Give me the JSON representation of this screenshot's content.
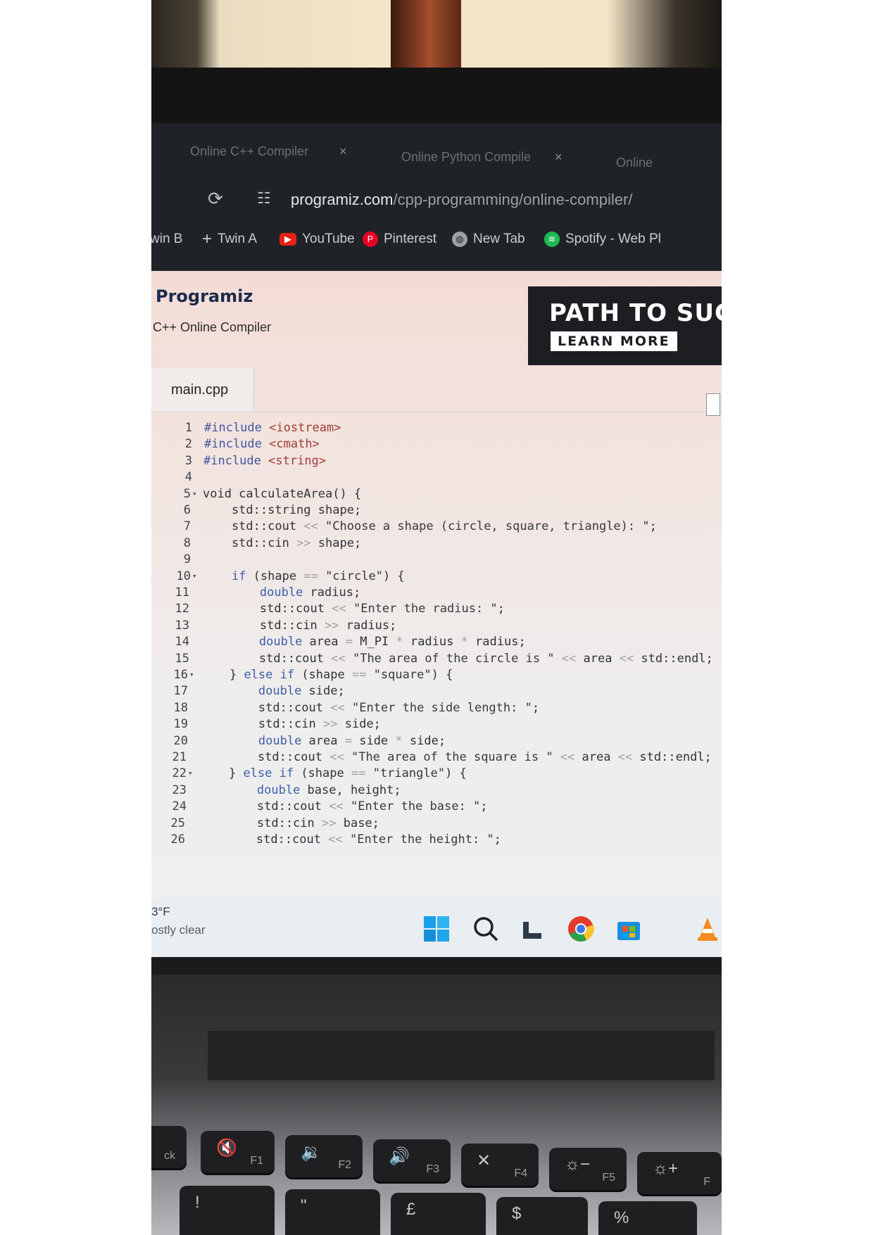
{
  "browser": {
    "tabs": [
      {
        "title": "Online C++ Compiler",
        "close": "×"
      },
      {
        "title": "Online Python Compile",
        "close": "×"
      },
      {
        "title": "Online"
      }
    ],
    "url_domain": "programiz.com",
    "url_path": "/cpp-programming/online-compiler/",
    "bookmarks": [
      {
        "label": "win B",
        "icon": "bookmark-icon"
      },
      {
        "label": "Twin A",
        "icon": "plus-icon"
      },
      {
        "label": "YouTube",
        "icon": "youtube-icon"
      },
      {
        "label": "Pinterest",
        "icon": "pinterest-icon"
      },
      {
        "label": "New Tab",
        "icon": "globe-icon"
      },
      {
        "label": "Spotify - Web Pl",
        "icon": "spotify-icon"
      }
    ]
  },
  "page": {
    "logo": "Programiz",
    "subtitle": "C++ Online Compiler",
    "banner_title": "PATH TO SUCC",
    "banner_button": "LEARN MORE",
    "file_tab": "main.cpp"
  },
  "code_lines": [
    {
      "n": "1",
      "fold": false
    },
    {
      "n": "2",
      "fold": false
    },
    {
      "n": "3",
      "fold": false
    },
    {
      "n": "4",
      "fold": false
    },
    {
      "n": "5",
      "fold": true
    },
    {
      "n": "6",
      "fold": false
    },
    {
      "n": "7",
      "fold": false
    },
    {
      "n": "8",
      "fold": false
    },
    {
      "n": "9",
      "fold": false
    },
    {
      "n": "10",
      "fold": true
    },
    {
      "n": "11",
      "fold": false
    },
    {
      "n": "12",
      "fold": false
    },
    {
      "n": "13",
      "fold": false
    },
    {
      "n": "14",
      "fold": false
    },
    {
      "n": "15",
      "fold": false
    },
    {
      "n": "16",
      "fold": true
    },
    {
      "n": "17",
      "fold": false
    },
    {
      "n": "18",
      "fold": false
    },
    {
      "n": "19",
      "fold": false
    },
    {
      "n": "20",
      "fold": false
    },
    {
      "n": "21",
      "fold": false
    },
    {
      "n": "22",
      "fold": true
    },
    {
      "n": "23",
      "fold": false
    },
    {
      "n": "24",
      "fold": false
    },
    {
      "n": "25",
      "fold": false
    },
    {
      "n": "26",
      "fold": false
    }
  ],
  "code": [
    [
      [
        "inc",
        "#include"
      ],
      [
        "t",
        " "
      ],
      [
        "hdr",
        "<iostream>"
      ]
    ],
    [
      [
        "inc",
        "#include"
      ],
      [
        "t",
        " "
      ],
      [
        "hdr",
        "<cmath>"
      ]
    ],
    [
      [
        "inc",
        "#include"
      ],
      [
        "t",
        " "
      ],
      [
        "hdr",
        "<string>"
      ]
    ],
    [],
    [
      [
        "t",
        "void calculateArea() {"
      ]
    ],
    [
      [
        "t",
        "    std::string shape;"
      ]
    ],
    [
      [
        "t",
        "    std::cout "
      ],
      [
        "op",
        "<<"
      ],
      [
        "t",
        " "
      ],
      [
        "str",
        "\"Choose a shape (circle, square, triangle): \""
      ],
      [
        "t",
        ";"
      ]
    ],
    [
      [
        "t",
        "    std::cin "
      ],
      [
        "op",
        ">>"
      ],
      [
        "t",
        " shape;"
      ]
    ],
    [],
    [
      [
        "t",
        "    "
      ],
      [
        "kw",
        "if"
      ],
      [
        "t",
        " (shape "
      ],
      [
        "op",
        "=="
      ],
      [
        "t",
        " "
      ],
      [
        "str",
        "\"circle\""
      ],
      [
        "t",
        ") {"
      ]
    ],
    [
      [
        "t",
        "        "
      ],
      [
        "kw",
        "double"
      ],
      [
        "t",
        " radius;"
      ]
    ],
    [
      [
        "t",
        "        std::cout "
      ],
      [
        "op",
        "<<"
      ],
      [
        "t",
        " "
      ],
      [
        "str",
        "\"Enter the radius: \""
      ],
      [
        "t",
        ";"
      ]
    ],
    [
      [
        "t",
        "        std::cin "
      ],
      [
        "op",
        ">>"
      ],
      [
        "t",
        " radius;"
      ]
    ],
    [
      [
        "t",
        "        "
      ],
      [
        "kw",
        "double"
      ],
      [
        "t",
        " area "
      ],
      [
        "op",
        "="
      ],
      [
        "t",
        " M_PI "
      ],
      [
        "op",
        "*"
      ],
      [
        "t",
        " radius "
      ],
      [
        "op",
        "*"
      ],
      [
        "t",
        " radius;"
      ]
    ],
    [
      [
        "t",
        "        std::cout "
      ],
      [
        "op",
        "<<"
      ],
      [
        "t",
        " "
      ],
      [
        "str",
        "\"The area of the circle is \""
      ],
      [
        "t",
        " "
      ],
      [
        "op",
        "<<"
      ],
      [
        "t",
        " area "
      ],
      [
        "op",
        "<<"
      ],
      [
        "t",
        " std::endl;"
      ]
    ],
    [
      [
        "t",
        "    } "
      ],
      [
        "kw",
        "else if"
      ],
      [
        "t",
        " (shape "
      ],
      [
        "op",
        "=="
      ],
      [
        "t",
        " "
      ],
      [
        "str",
        "\"square\""
      ],
      [
        "t",
        ") {"
      ]
    ],
    [
      [
        "t",
        "        "
      ],
      [
        "kw",
        "double"
      ],
      [
        "t",
        " side;"
      ]
    ],
    [
      [
        "t",
        "        std::cout "
      ],
      [
        "op",
        "<<"
      ],
      [
        "t",
        " "
      ],
      [
        "str",
        "\"Enter the side length: \""
      ],
      [
        "t",
        ";"
      ]
    ],
    [
      [
        "t",
        "        std::cin "
      ],
      [
        "op",
        ">>"
      ],
      [
        "t",
        " side;"
      ]
    ],
    [
      [
        "t",
        "        "
      ],
      [
        "kw",
        "double"
      ],
      [
        "t",
        " area "
      ],
      [
        "op",
        "="
      ],
      [
        "t",
        " side "
      ],
      [
        "op",
        "*"
      ],
      [
        "t",
        " side;"
      ]
    ],
    [
      [
        "t",
        "        std::cout "
      ],
      [
        "op",
        "<<"
      ],
      [
        "t",
        " "
      ],
      [
        "str",
        "\"The area of the square is \""
      ],
      [
        "t",
        " "
      ],
      [
        "op",
        "<<"
      ],
      [
        "t",
        " area "
      ],
      [
        "op",
        "<<"
      ],
      [
        "t",
        " std::endl;"
      ]
    ],
    [
      [
        "t",
        "    } "
      ],
      [
        "kw",
        "else if"
      ],
      [
        "t",
        " (shape "
      ],
      [
        "op",
        "=="
      ],
      [
        "t",
        " "
      ],
      [
        "str",
        "\"triangle\""
      ],
      [
        "t",
        ") {"
      ]
    ],
    [
      [
        "t",
        "        "
      ],
      [
        "kw",
        "double"
      ],
      [
        "t",
        " base, height;"
      ]
    ],
    [
      [
        "t",
        "        std::cout "
      ],
      [
        "op",
        "<<"
      ],
      [
        "t",
        " "
      ],
      [
        "str",
        "\"Enter the base: \""
      ],
      [
        "t",
        ";"
      ]
    ],
    [
      [
        "t",
        "        std::cin "
      ],
      [
        "op",
        ">>"
      ],
      [
        "t",
        " base;"
      ]
    ],
    [
      [
        "t",
        "        std::cout "
      ],
      [
        "op",
        "<<"
      ],
      [
        "t",
        " "
      ],
      [
        "str",
        "\"Enter the height: \""
      ],
      [
        "t",
        ";"
      ]
    ]
  ],
  "taskbar": {
    "temperature": "3°F",
    "condition": "ostly clear",
    "icons": [
      "windows-start-icon",
      "search-icon",
      "file-explorer-icon",
      "chrome-icon",
      "store-icon",
      "vlc-icon"
    ]
  },
  "keyboard": {
    "keys": [
      {
        "symbol": "",
        "label": "ck"
      },
      {
        "symbol": "🔇",
        "label": "F1"
      },
      {
        "symbol": "🔉",
        "label": "F2"
      },
      {
        "symbol": "🔊",
        "label": "F3"
      },
      {
        "symbol": "✕",
        "label": "F4"
      },
      {
        "symbol": "☼−",
        "label": "F5"
      },
      {
        "symbol": "☼+",
        "label": "F"
      }
    ],
    "lower_row": [
      "!",
      "\"",
      "£",
      "$",
      "%"
    ]
  },
  "colors": {
    "chrome_bg": "#1f2327",
    "page_bg": "#f3e2dc",
    "keyword": "#3a5fa8",
    "include_header": "#a03a36",
    "banner_bg": "#1d1e22"
  }
}
